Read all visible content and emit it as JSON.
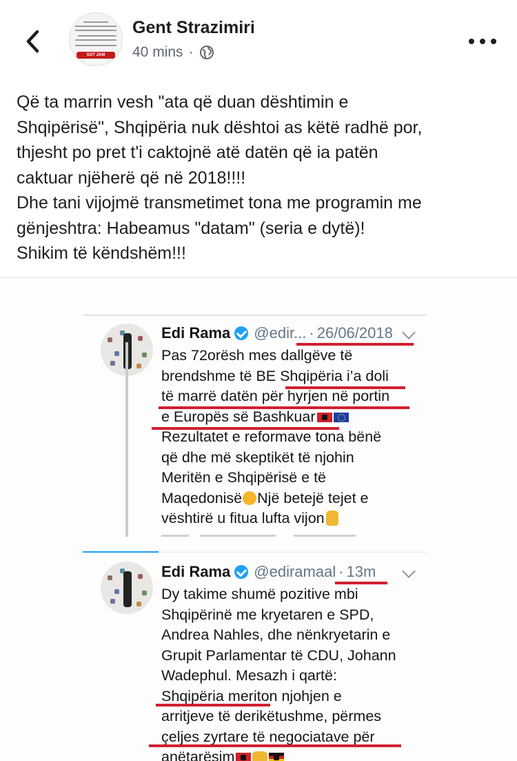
{
  "header": {
    "author": "Gent Strazimiri",
    "time": "40 mins",
    "separator": "·",
    "back_icon": "chevron-left-icon",
    "privacy_icon": "globe-icon",
    "more_icon": "more-horizontal-icon",
    "avatar_banner": "SOT JAM STUDENT"
  },
  "post": {
    "lines": [
      "Që ta marrin vesh \"ata që duan dështimin e",
      "Shqipërisë\", Shqipëria nuk dështoi as këtë radhë por,",
      "thjesht po pret t'i caktojnë atë datën që ia patën",
      "caktuar njëherë që në 2018!!!!",
      "Dhe tani vijojmë transmetimet tona me programin me",
      "gënjeshtra: Habeamus \"datam\" (seria e dytë)!",
      "Shikim të këndshëm!!!"
    ]
  },
  "tweets": [
    {
      "name": "Edi Rama",
      "handle": "@edir...",
      "separator": "·",
      "date": "26/06/2018",
      "lines": [
        "Pas 72orësh mes dallgëve të",
        "brendshme të BE Shqipëria i’a doli",
        "të marrë datën për hyrjen në portin",
        "e Europës së Bashkuar",
        "Rezultatet e reformave tona bënë",
        "që dhe më skeptikët të njohin",
        "Meritën e Shqipërisë e të",
        "Maqedonisë",
        "Një betejë tejet e",
        "vështirë u fitua lufta vijon"
      ]
    },
    {
      "name": "Edi Rama",
      "handle": "@ediramaal",
      "separator": "·",
      "date": "13m",
      "lines": [
        "Dy takime shumë pozitive mbi",
        "Shqipërinë me kryetaren e SPD,",
        "Andrea Nahles, dhe nënkryetarin e",
        "Grupit Parlamentar të CDU, Johann",
        "Wadephul. Mesazh i qartë:",
        "Shqipëria meriton njohjen e",
        "arritjeve të derikëtushme, përmes",
        "çeljes zyrtare të negociatave për",
        "anëtarësim"
      ]
    }
  ],
  "colors": {
    "underline": "#d21f2f",
    "verified": "#1da1f2",
    "text": "#1c1e21",
    "meta": "#606770"
  }
}
